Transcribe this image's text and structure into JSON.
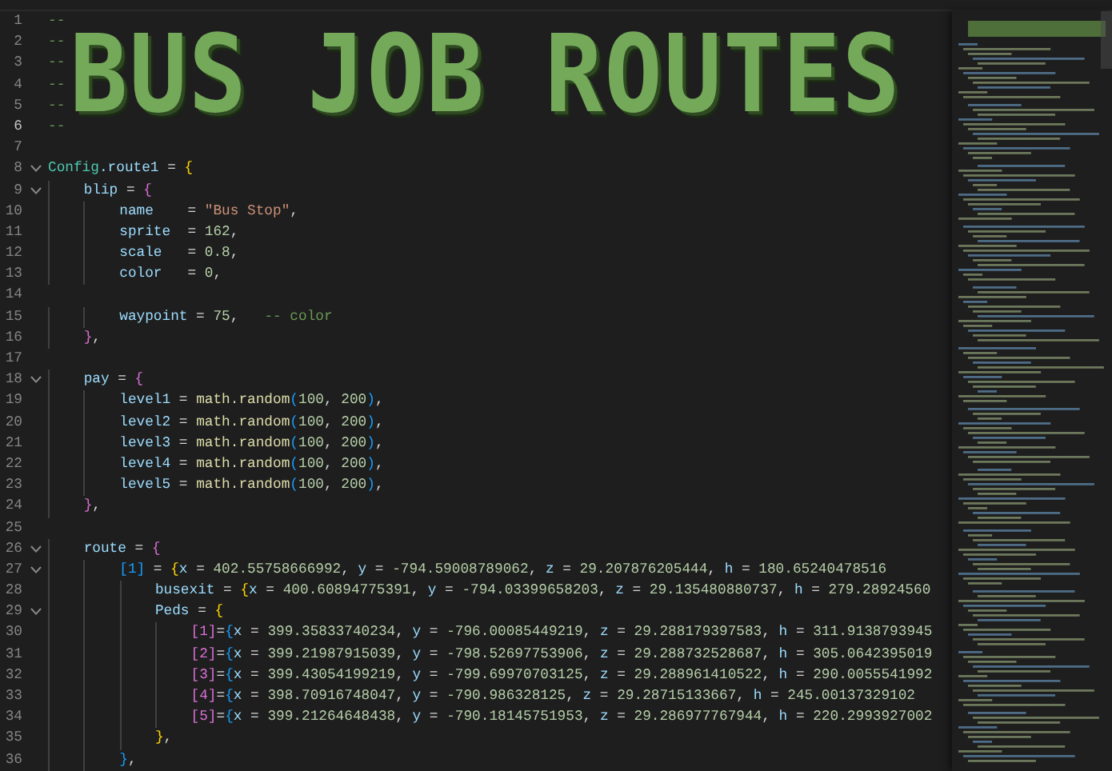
{
  "banner": {
    "text": "BUS JOB ROUTES",
    "comment_marks": [
      {
        "text": "--"
      },
      {
        "text": "--"
      },
      {
        "text": "--"
      },
      {
        "text": "--"
      },
      {
        "text": "--"
      },
      {
        "text": "--"
      }
    ]
  },
  "banner_lines": [
    {
      "number": "1",
      "active": false
    },
    {
      "number": "2",
      "active": false
    },
    {
      "number": "3",
      "active": false
    },
    {
      "number": "4",
      "active": false
    },
    {
      "number": "5",
      "active": false
    },
    {
      "number": "6",
      "active": true
    }
  ],
  "lines": [
    {
      "number": "7",
      "active": false,
      "foldable": false
    },
    {
      "number": "8",
      "active": false,
      "foldable": true,
      "tokens": [
        {
          "kind": "cls",
          "text": "Config"
        },
        {
          "kind": "prop",
          "text": ".route1"
        },
        {
          "kind": "op",
          "text": " = "
        },
        {
          "kind": "b1",
          "text": "{"
        }
      ]
    },
    {
      "number": "9",
      "active": false,
      "foldable": true,
      "tokens": [
        {
          "kind": "prop",
          "text": "    blip"
        },
        {
          "kind": "op",
          "text": " = "
        },
        {
          "kind": "b2",
          "text": "{"
        }
      ]
    },
    {
      "number": "10",
      "active": false,
      "foldable": false,
      "tokens": [
        {
          "kind": "prop",
          "text": "        name"
        },
        {
          "kind": "op",
          "text": "    = "
        },
        {
          "kind": "str",
          "text": "\"Bus Stop\""
        },
        {
          "kind": "op",
          "text": ","
        }
      ]
    },
    {
      "number": "11",
      "active": false,
      "foldable": false,
      "tokens": [
        {
          "kind": "prop",
          "text": "        sprite"
        },
        {
          "kind": "op",
          "text": "  = "
        },
        {
          "kind": "num",
          "text": "162"
        },
        {
          "kind": "op",
          "text": ","
        }
      ]
    },
    {
      "number": "12",
      "active": false,
      "foldable": false,
      "tokens": [
        {
          "kind": "prop",
          "text": "        scale"
        },
        {
          "kind": "op",
          "text": "   = "
        },
        {
          "kind": "num",
          "text": "0.8"
        },
        {
          "kind": "op",
          "text": ","
        }
      ]
    },
    {
      "number": "13",
      "active": false,
      "foldable": false,
      "tokens": [
        {
          "kind": "prop",
          "text": "        color"
        },
        {
          "kind": "op",
          "text": "   = "
        },
        {
          "kind": "num",
          "text": "0"
        },
        {
          "kind": "op",
          "text": ","
        }
      ]
    },
    {
      "number": "14",
      "active": false,
      "foldable": false
    },
    {
      "number": "15",
      "active": false,
      "foldable": false,
      "tokens": [
        {
          "kind": "prop",
          "text": "        waypoint"
        },
        {
          "kind": "op",
          "text": " = "
        },
        {
          "kind": "num",
          "text": "75"
        },
        {
          "kind": "op",
          "text": ",   "
        },
        {
          "kind": "comment",
          "text": "-- color"
        }
      ]
    },
    {
      "number": "16",
      "active": false,
      "foldable": false,
      "tokens": [
        {
          "kind": "b2",
          "text": "    }"
        },
        {
          "kind": "op",
          "text": ","
        }
      ]
    },
    {
      "number": "17",
      "active": false,
      "foldable": false
    },
    {
      "number": "18",
      "active": false,
      "foldable": true,
      "tokens": [
        {
          "kind": "prop",
          "text": "    pay"
        },
        {
          "kind": "op",
          "text": " = "
        },
        {
          "kind": "b2",
          "text": "{"
        }
      ]
    },
    {
      "number": "19",
      "active": false,
      "foldable": false,
      "tokens": [
        {
          "kind": "prop",
          "text": "        level1"
        },
        {
          "kind": "op",
          "text": " = "
        },
        {
          "kind": "func",
          "text": "math.random"
        },
        {
          "kind": "b3",
          "text": "("
        },
        {
          "kind": "num",
          "text": "100"
        },
        {
          "kind": "op",
          "text": ", "
        },
        {
          "kind": "num",
          "text": "200"
        },
        {
          "kind": "b3",
          "text": ")"
        },
        {
          "kind": "op",
          "text": ","
        }
      ]
    },
    {
      "number": "20",
      "active": false,
      "foldable": false,
      "tokens": [
        {
          "kind": "prop",
          "text": "        level2"
        },
        {
          "kind": "op",
          "text": " = "
        },
        {
          "kind": "func",
          "text": "math.random"
        },
        {
          "kind": "b3",
          "text": "("
        },
        {
          "kind": "num",
          "text": "100"
        },
        {
          "kind": "op",
          "text": ", "
        },
        {
          "kind": "num",
          "text": "200"
        },
        {
          "kind": "b3",
          "text": ")"
        },
        {
          "kind": "op",
          "text": ","
        }
      ]
    },
    {
      "number": "21",
      "active": false,
      "foldable": false,
      "tokens": [
        {
          "kind": "prop",
          "text": "        level3"
        },
        {
          "kind": "op",
          "text": " = "
        },
        {
          "kind": "func",
          "text": "math.random"
        },
        {
          "kind": "b3",
          "text": "("
        },
        {
          "kind": "num",
          "text": "100"
        },
        {
          "kind": "op",
          "text": ", "
        },
        {
          "kind": "num",
          "text": "200"
        },
        {
          "kind": "b3",
          "text": ")"
        },
        {
          "kind": "op",
          "text": ","
        }
      ]
    },
    {
      "number": "22",
      "active": false,
      "foldable": false,
      "tokens": [
        {
          "kind": "prop",
          "text": "        level4"
        },
        {
          "kind": "op",
          "text": " = "
        },
        {
          "kind": "func",
          "text": "math.random"
        },
        {
          "kind": "b3",
          "text": "("
        },
        {
          "kind": "num",
          "text": "100"
        },
        {
          "kind": "op",
          "text": ", "
        },
        {
          "kind": "num",
          "text": "200"
        },
        {
          "kind": "b3",
          "text": ")"
        },
        {
          "kind": "op",
          "text": ","
        }
      ]
    },
    {
      "number": "23",
      "active": false,
      "foldable": false,
      "tokens": [
        {
          "kind": "prop",
          "text": "        level5"
        },
        {
          "kind": "op",
          "text": " = "
        },
        {
          "kind": "func",
          "text": "math.random"
        },
        {
          "kind": "b3",
          "text": "("
        },
        {
          "kind": "num",
          "text": "100"
        },
        {
          "kind": "op",
          "text": ", "
        },
        {
          "kind": "num",
          "text": "200"
        },
        {
          "kind": "b3",
          "text": ")"
        },
        {
          "kind": "op",
          "text": ","
        }
      ]
    },
    {
      "number": "24",
      "active": false,
      "foldable": false,
      "tokens": [
        {
          "kind": "b2",
          "text": "    }"
        },
        {
          "kind": "op",
          "text": ","
        }
      ]
    },
    {
      "number": "25",
      "active": false,
      "foldable": false
    },
    {
      "number": "26",
      "active": false,
      "foldable": true,
      "tokens": [
        {
          "kind": "prop",
          "text": "    route"
        },
        {
          "kind": "op",
          "text": " = "
        },
        {
          "kind": "b2",
          "text": "{"
        }
      ]
    },
    {
      "number": "27",
      "active": false,
      "foldable": true,
      "tokens": [
        {
          "kind": "b3",
          "text": "        [1]"
        },
        {
          "kind": "op",
          "text": " = "
        },
        {
          "kind": "b1",
          "text": "{"
        },
        {
          "kind": "prop",
          "text": "x"
        },
        {
          "kind": "op",
          "text": " = "
        },
        {
          "kind": "num",
          "text": "402.55758666992"
        },
        {
          "kind": "op",
          "text": ", "
        },
        {
          "kind": "prop",
          "text": "y"
        },
        {
          "kind": "op",
          "text": " = "
        },
        {
          "kind": "num",
          "text": "-794.59008789062"
        },
        {
          "kind": "op",
          "text": ", "
        },
        {
          "kind": "prop",
          "text": "z"
        },
        {
          "kind": "op",
          "text": " = "
        },
        {
          "kind": "num",
          "text": "29.207876205444"
        },
        {
          "kind": "op",
          "text": ", "
        },
        {
          "kind": "prop",
          "text": "h"
        },
        {
          "kind": "op",
          "text": " = "
        },
        {
          "kind": "num",
          "text": "180.65240478516"
        }
      ]
    },
    {
      "number": "28",
      "active": false,
      "foldable": false,
      "tokens": [
        {
          "kind": "prop",
          "text": "            busexit"
        },
        {
          "kind": "op",
          "text": " = "
        },
        {
          "kind": "b1",
          "text": "{"
        },
        {
          "kind": "prop",
          "text": "x"
        },
        {
          "kind": "op",
          "text": " = "
        },
        {
          "kind": "num",
          "text": "400.60894775391"
        },
        {
          "kind": "op",
          "text": ", "
        },
        {
          "kind": "prop",
          "text": "y"
        },
        {
          "kind": "op",
          "text": " = "
        },
        {
          "kind": "num",
          "text": "-794.03399658203"
        },
        {
          "kind": "op",
          "text": ", "
        },
        {
          "kind": "prop",
          "text": "z"
        },
        {
          "kind": "op",
          "text": " = "
        },
        {
          "kind": "num",
          "text": "29.135480880737"
        },
        {
          "kind": "op",
          "text": ", "
        },
        {
          "kind": "prop",
          "text": "h"
        },
        {
          "kind": "op",
          "text": " = "
        },
        {
          "kind": "num",
          "text": "279.28924560"
        }
      ]
    },
    {
      "number": "29",
      "active": false,
      "foldable": true,
      "tokens": [
        {
          "kind": "prop",
          "text": "            Peds"
        },
        {
          "kind": "op",
          "text": " = "
        },
        {
          "kind": "b1",
          "text": "{"
        }
      ]
    },
    {
      "number": "30",
      "active": false,
      "foldable": false,
      "tokens": [
        {
          "kind": "b2",
          "text": "                [1]"
        },
        {
          "kind": "op",
          "text": "="
        },
        {
          "kind": "b3",
          "text": "{"
        },
        {
          "kind": "prop",
          "text": "x"
        },
        {
          "kind": "op",
          "text": " = "
        },
        {
          "kind": "num",
          "text": "399.35833740234"
        },
        {
          "kind": "op",
          "text": ", "
        },
        {
          "kind": "prop",
          "text": "y"
        },
        {
          "kind": "op",
          "text": " = "
        },
        {
          "kind": "num",
          "text": "-796.00085449219"
        },
        {
          "kind": "op",
          "text": ", "
        },
        {
          "kind": "prop",
          "text": "z"
        },
        {
          "kind": "op",
          "text": " = "
        },
        {
          "kind": "num",
          "text": "29.288179397583"
        },
        {
          "kind": "op",
          "text": ", "
        },
        {
          "kind": "prop",
          "text": "h"
        },
        {
          "kind": "op",
          "text": " = "
        },
        {
          "kind": "num",
          "text": "311.9138793945"
        }
      ]
    },
    {
      "number": "31",
      "active": false,
      "foldable": false,
      "tokens": [
        {
          "kind": "b2",
          "text": "                [2]"
        },
        {
          "kind": "op",
          "text": "="
        },
        {
          "kind": "b3",
          "text": "{"
        },
        {
          "kind": "prop",
          "text": "x"
        },
        {
          "kind": "op",
          "text": " = "
        },
        {
          "kind": "num",
          "text": "399.21987915039"
        },
        {
          "kind": "op",
          "text": ", "
        },
        {
          "kind": "prop",
          "text": "y"
        },
        {
          "kind": "op",
          "text": " = "
        },
        {
          "kind": "num",
          "text": "-798.52697753906"
        },
        {
          "kind": "op",
          "text": ", "
        },
        {
          "kind": "prop",
          "text": "z"
        },
        {
          "kind": "op",
          "text": " = "
        },
        {
          "kind": "num",
          "text": "29.288732528687"
        },
        {
          "kind": "op",
          "text": ", "
        },
        {
          "kind": "prop",
          "text": "h"
        },
        {
          "kind": "op",
          "text": " = "
        },
        {
          "kind": "num",
          "text": "305.0642395019"
        }
      ]
    },
    {
      "number": "32",
      "active": false,
      "foldable": false,
      "tokens": [
        {
          "kind": "b2",
          "text": "                [3]"
        },
        {
          "kind": "op",
          "text": "="
        },
        {
          "kind": "b3",
          "text": "{"
        },
        {
          "kind": "prop",
          "text": "x"
        },
        {
          "kind": "op",
          "text": " = "
        },
        {
          "kind": "num",
          "text": "399.43054199219"
        },
        {
          "kind": "op",
          "text": ", "
        },
        {
          "kind": "prop",
          "text": "y"
        },
        {
          "kind": "op",
          "text": " = "
        },
        {
          "kind": "num",
          "text": "-799.69970703125"
        },
        {
          "kind": "op",
          "text": ", "
        },
        {
          "kind": "prop",
          "text": "z"
        },
        {
          "kind": "op",
          "text": " = "
        },
        {
          "kind": "num",
          "text": "29.288961410522"
        },
        {
          "kind": "op",
          "text": ", "
        },
        {
          "kind": "prop",
          "text": "h"
        },
        {
          "kind": "op",
          "text": " = "
        },
        {
          "kind": "num",
          "text": "290.0055541992"
        }
      ]
    },
    {
      "number": "33",
      "active": false,
      "foldable": false,
      "tokens": [
        {
          "kind": "b2",
          "text": "                [4]"
        },
        {
          "kind": "op",
          "text": "="
        },
        {
          "kind": "b3",
          "text": "{"
        },
        {
          "kind": "prop",
          "text": "x"
        },
        {
          "kind": "op",
          "text": " = "
        },
        {
          "kind": "num",
          "text": "398.70916748047"
        },
        {
          "kind": "op",
          "text": ", "
        },
        {
          "kind": "prop",
          "text": "y"
        },
        {
          "kind": "op",
          "text": " = "
        },
        {
          "kind": "num",
          "text": "-790.986328125"
        },
        {
          "kind": "op",
          "text": ", "
        },
        {
          "kind": "prop",
          "text": "z"
        },
        {
          "kind": "op",
          "text": " = "
        },
        {
          "kind": "num",
          "text": "29.28715133667"
        },
        {
          "kind": "op",
          "text": ", "
        },
        {
          "kind": "prop",
          "text": "h"
        },
        {
          "kind": "op",
          "text": " = "
        },
        {
          "kind": "num",
          "text": "245.00137329102"
        }
      ]
    },
    {
      "number": "34",
      "active": false,
      "foldable": false,
      "tokens": [
        {
          "kind": "b2",
          "text": "                [5]"
        },
        {
          "kind": "op",
          "text": "="
        },
        {
          "kind": "b3",
          "text": "{"
        },
        {
          "kind": "prop",
          "text": "x"
        },
        {
          "kind": "op",
          "text": " = "
        },
        {
          "kind": "num",
          "text": "399.21264648438"
        },
        {
          "kind": "op",
          "text": ", "
        },
        {
          "kind": "prop",
          "text": "y"
        },
        {
          "kind": "op",
          "text": " = "
        },
        {
          "kind": "num",
          "text": "-790.18145751953"
        },
        {
          "kind": "op",
          "text": ", "
        },
        {
          "kind": "prop",
          "text": "z"
        },
        {
          "kind": "op",
          "text": " = "
        },
        {
          "kind": "num",
          "text": "29.286977767944"
        },
        {
          "kind": "op",
          "text": ", "
        },
        {
          "kind": "prop",
          "text": "h"
        },
        {
          "kind": "op",
          "text": " = "
        },
        {
          "kind": "num",
          "text": "220.2993927002"
        }
      ]
    },
    {
      "number": "35",
      "active": false,
      "foldable": false,
      "tokens": [
        {
          "kind": "b1",
          "text": "            }"
        },
        {
          "kind": "op",
          "text": ","
        }
      ]
    },
    {
      "number": "36",
      "active": false,
      "foldable": false,
      "tokens": [
        {
          "kind": "b3",
          "text": "        }"
        },
        {
          "kind": "op",
          "text": ","
        }
      ]
    }
  ]
}
